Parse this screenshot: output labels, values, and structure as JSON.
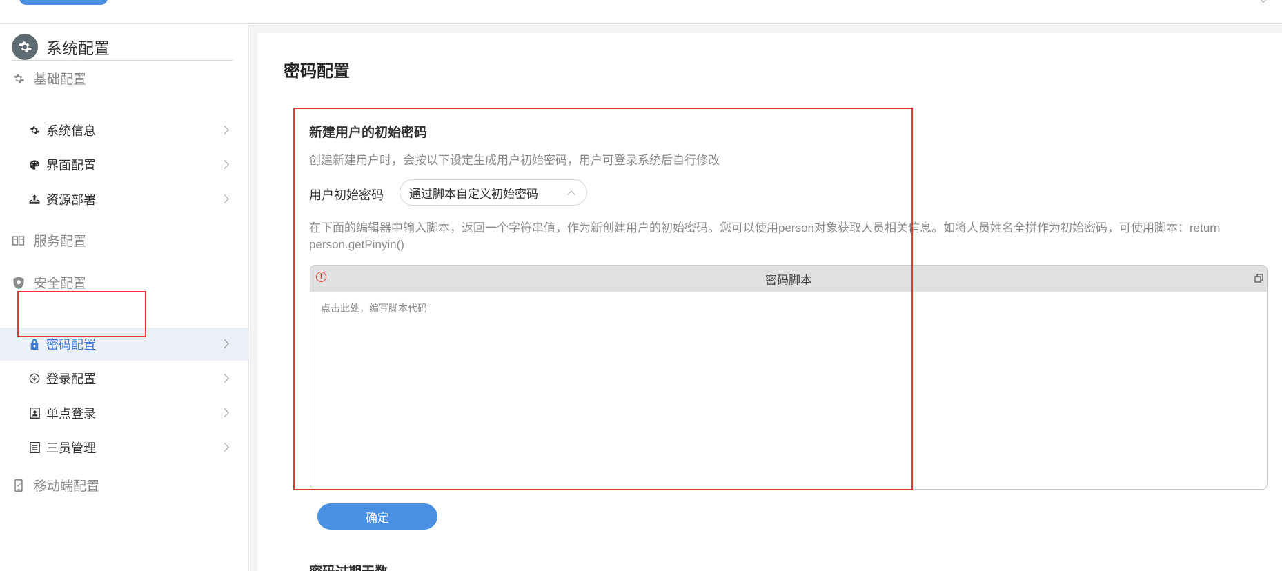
{
  "sidebar": {
    "header": {
      "title": "系统配置",
      "icon": "gear-icon"
    },
    "groups": [
      {
        "label": "基础配置",
        "icon": "gear-icon"
      },
      {
        "label": "服务配置",
        "icon": "server-icon"
      },
      {
        "label": "安全配置",
        "icon": "shield-icon"
      },
      {
        "label": "移动端配置",
        "icon": "mobile-icon"
      }
    ],
    "items": [
      {
        "label": "系统信息",
        "icon": "gear-icon"
      },
      {
        "label": "界面配置",
        "icon": "palette-icon"
      },
      {
        "label": "资源部署",
        "icon": "upload-icon"
      },
      {
        "label": "密码配置",
        "icon": "lock-icon",
        "active": true
      },
      {
        "label": "登录配置",
        "icon": "login-icon"
      },
      {
        "label": "单点登录",
        "icon": "id-card-icon"
      },
      {
        "label": "三员管理",
        "icon": "document-icon"
      }
    ]
  },
  "main": {
    "page_title": "密码配置",
    "section": {
      "title": "新建用户的初始密码",
      "description": "创建新建用户时，会按以下设定生成用户初始密码，用户可登录系统后自行修改",
      "field_label": "用户初始密码",
      "select_value": "通过脚本自定义初始密码",
      "hint": "在下面的编辑器中输入脚本，返回一个字符串值，作为新创建用户的初始密码。您可以使用person对象获取人员相关信息。如将人员姓名全拼作为初始密码，可使用脚本：return person.getPinyin()",
      "editor": {
        "title": "密码脚本",
        "placeholder": "点击此处，编写脚本代码"
      },
      "confirm_label": "确定"
    },
    "next_section_title": "密码过期天数"
  },
  "colors": {
    "accent": "#4a90e2",
    "active_text": "#3a7bd5",
    "active_bg": "#ebf0f8",
    "highlight_box": "#e53935"
  }
}
